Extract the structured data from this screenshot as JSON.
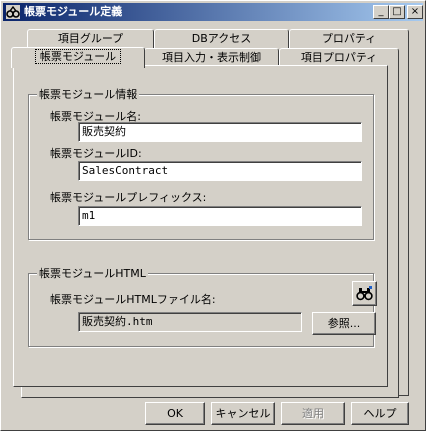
{
  "window": {
    "title": "帳票モジュール定義"
  },
  "caption_buttons": {
    "minimize": "_",
    "maximize": "□",
    "close": "×"
  },
  "tabs_back": [
    {
      "label": "項目グループ"
    },
    {
      "label": "DBアクセス"
    },
    {
      "label": "プロパティ"
    }
  ],
  "tabs_front": [
    {
      "label": "帳票モジュール",
      "selected": true
    },
    {
      "label": "項目入力・表示制御"
    },
    {
      "label": "項目プロパティ"
    }
  ],
  "module_info": {
    "legend": "帳票モジュール情報",
    "name_label": "帳票モジュール名:",
    "name_value": "販売契約",
    "id_label": "帳票モジュールID:",
    "id_value": "SalesContract",
    "prefix_label": "帳票モジュールプレフィックス:",
    "prefix_value": "m1"
  },
  "module_html": {
    "legend": "帳票モジュールHTML",
    "file_label": "帳票モジュールHTMLファイル名:",
    "file_value": "販売契約.htm",
    "browse_label": "参照...",
    "tool_icon": "binoculars-icon"
  },
  "footer": {
    "ok": "OK",
    "cancel": "キャンセル",
    "apply": "適用",
    "help": "ヘルプ"
  },
  "colors": {
    "titlebar_start": "#0a246a",
    "titlebar_end": "#a6caf0",
    "face": "#d4d0c8"
  }
}
